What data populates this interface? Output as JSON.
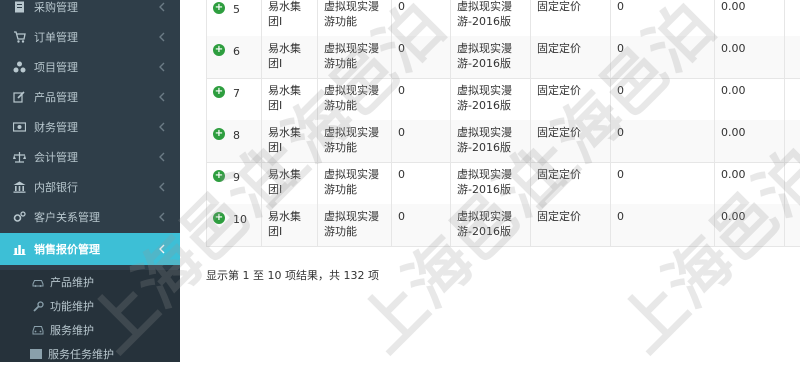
{
  "sidebar": {
    "items": [
      {
        "label": "采购管理",
        "icon": "document-icon"
      },
      {
        "label": "订单管理",
        "icon": "cart-icon"
      },
      {
        "label": "项目管理",
        "icon": "sitemap-icon"
      },
      {
        "label": "产品管理",
        "icon": "edit-icon"
      },
      {
        "label": "财务管理",
        "icon": "money-icon"
      },
      {
        "label": "会计管理",
        "icon": "scale-icon"
      },
      {
        "label": "内部银行",
        "icon": "bank-icon"
      },
      {
        "label": "客户关系管理",
        "icon": "cogs-icon"
      },
      {
        "label": "销售报价管理",
        "icon": "bar-chart-icon"
      }
    ],
    "sub_items": [
      {
        "label": "产品维护",
        "icon": "car-icon"
      },
      {
        "label": "功能维护",
        "icon": "wrench-icon"
      },
      {
        "label": "服务维护",
        "icon": "car-front-icon"
      },
      {
        "label": "服务任务维护",
        "icon": "list-icon"
      }
    ]
  },
  "table": {
    "rows": [
      {
        "no": "5",
        "company": "易水集团I",
        "func": "虚拟现实漫游功能",
        "v1": "0",
        "version": "虚拟现实漫游-2016版",
        "pricing": "固定定价",
        "v2": "0",
        "amount": "0.00"
      },
      {
        "no": "6",
        "company": "易水集团I",
        "func": "虚拟现实漫游功能",
        "v1": "0",
        "version": "虚拟现实漫游-2016版",
        "pricing": "固定定价",
        "v2": "0",
        "amount": "0.00"
      },
      {
        "no": "7",
        "company": "易水集团I",
        "func": "虚拟现实漫游功能",
        "v1": "0",
        "version": "虚拟现实漫游-2016版",
        "pricing": "固定定价",
        "v2": "0",
        "amount": "0.00"
      },
      {
        "no": "8",
        "company": "易水集团I",
        "func": "虚拟现实漫游功能",
        "v1": "0",
        "version": "虚拟现实漫游-2016版",
        "pricing": "固定定价",
        "v2": "0",
        "amount": "0.00"
      },
      {
        "no": "9",
        "company": "易水集团I",
        "func": "虚拟现实漫游功能",
        "v1": "0",
        "version": "虚拟现实漫游-2016版",
        "pricing": "固定定价",
        "v2": "0",
        "amount": "0.00"
      },
      {
        "no": "10",
        "company": "易水集团I",
        "func": "虚拟现实漫游功能",
        "v1": "0",
        "version": "虚拟现实漫游-2016版",
        "pricing": "固定定价",
        "v2": "0",
        "amount": "0.00"
      }
    ],
    "summary": "显示第 1 至 10 项结果，共 132 项"
  },
  "watermark": "上海邑泊",
  "colors": {
    "sidebar_bg": "#2f3e49",
    "active": "#3dbfd6",
    "expand_icon": "#2e9e3f"
  }
}
